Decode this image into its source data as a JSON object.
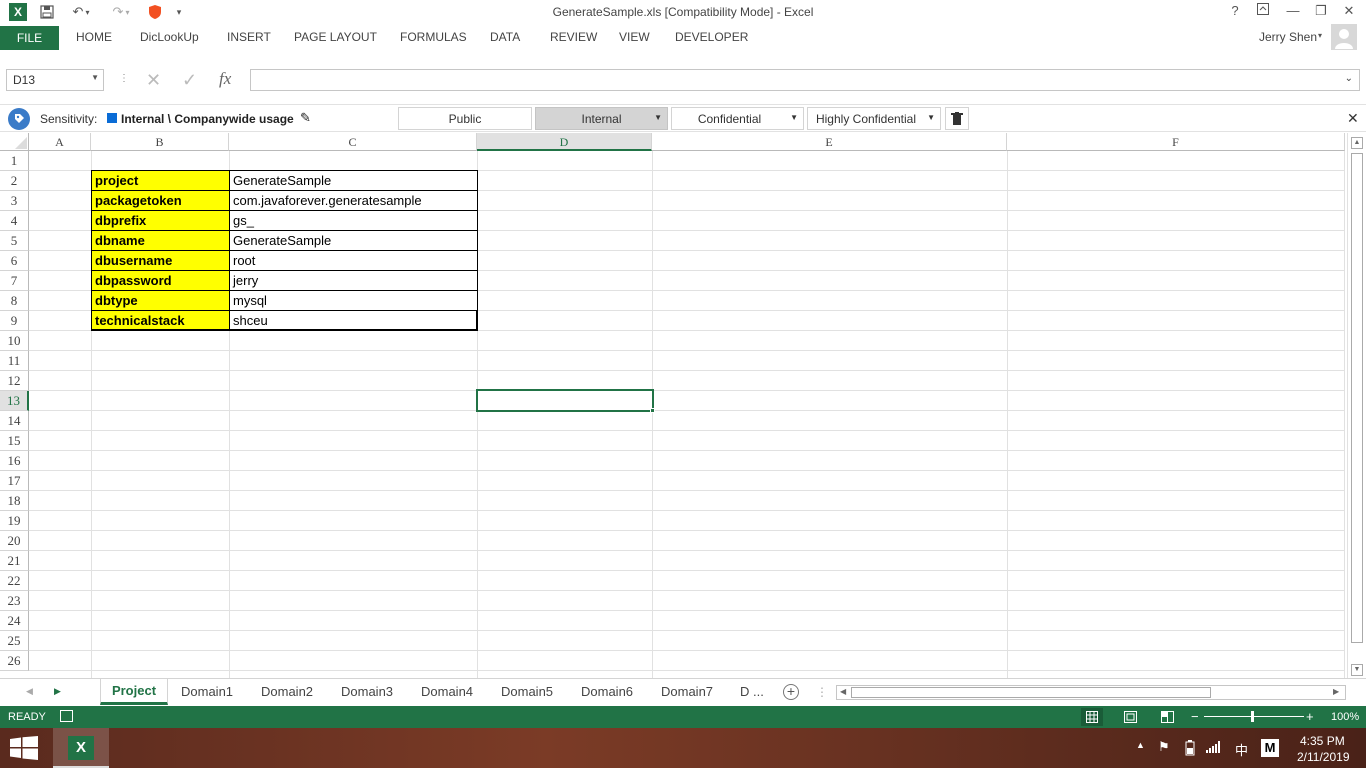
{
  "window": {
    "title": "GenerateSample.xls  [Compatibility Mode] - Excel",
    "user": "Jerry Shen",
    "help": "?"
  },
  "ribbon": {
    "tabs": [
      "FILE",
      "HOME",
      "DicLookUp",
      "INSERT",
      "PAGE LAYOUT",
      "FORMULAS",
      "DATA",
      "REVIEW",
      "VIEW",
      "DEVELOPER"
    ]
  },
  "formula_bar": {
    "name_box": "D13",
    "fx": "fx",
    "value": ""
  },
  "sensitivity": {
    "label": "Sensitivity:",
    "current": "Internal \\ Companywide usage",
    "options": [
      "Public",
      "Internal",
      "Confidential",
      "Highly Confidential"
    ]
  },
  "sheet": {
    "columns": [
      "A",
      "B",
      "C",
      "D",
      "E",
      "F"
    ],
    "rows": [
      "1",
      "2",
      "3",
      "4",
      "5",
      "6",
      "7",
      "8",
      "9",
      "10",
      "11",
      "12",
      "13",
      "14",
      "15",
      "16",
      "17",
      "18",
      "19",
      "20",
      "21",
      "22",
      "23",
      "24",
      "25",
      "26"
    ],
    "selected_cell": "D13",
    "table": [
      {
        "key": "project",
        "value": "GenerateSample"
      },
      {
        "key": "packagetoken",
        "value": "com.javaforever.generatesample"
      },
      {
        "key": "dbprefix",
        "value": "gs_"
      },
      {
        "key": "dbname",
        "value": "GenerateSample"
      },
      {
        "key": "dbusername",
        "value": "root"
      },
      {
        "key": "dbpassword",
        "value": "jerry"
      },
      {
        "key": "dbtype",
        "value": "mysql"
      },
      {
        "key": "technicalstack",
        "value": "shceu"
      }
    ]
  },
  "sheet_tabs": [
    "Project",
    "Domain1",
    "Domain2",
    "Domain3",
    "Domain4",
    "Domain5",
    "Domain6",
    "Domain7",
    "D ..."
  ],
  "status": {
    "ready": "READY",
    "zoom": "100%"
  },
  "taskbar": {
    "time": "4:35 PM",
    "date": "2/11/2019",
    "ime": "中",
    "ime2": "M"
  },
  "colors": {
    "excel_green": "#217346",
    "key_fill": "#ffff00",
    "selection": "#217346"
  }
}
